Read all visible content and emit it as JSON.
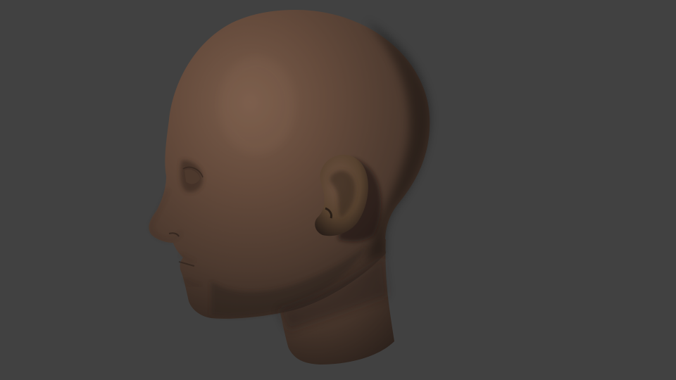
{
  "scene": {
    "subject": "head-model-render",
    "background_color": "#414141",
    "skin_base_color": "#5a4538",
    "skin_highlight_color": "#7a5d4b",
    "skin_shadow_color": "#2a1f19"
  }
}
